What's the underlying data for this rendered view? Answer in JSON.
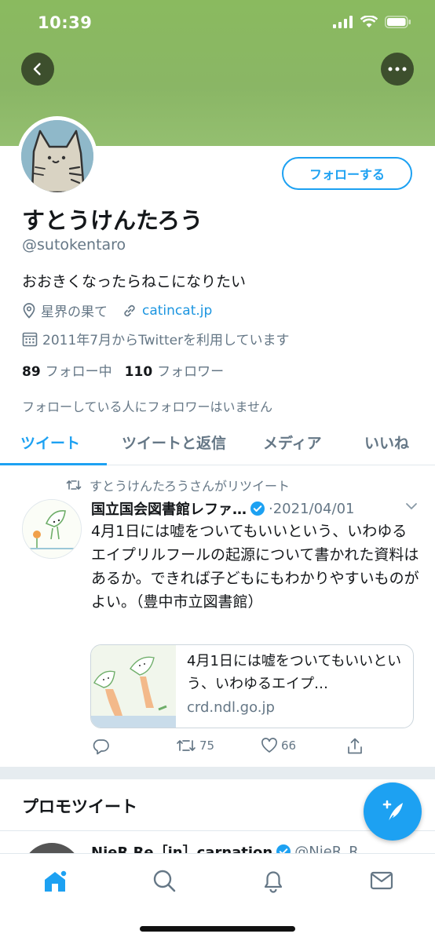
{
  "status_bar": {
    "time": "10:39"
  },
  "colors": {
    "accent": "#1da1f2",
    "banner": "#8ab665",
    "text_secondary": "#657786"
  },
  "header": {
    "back_icon": "chevron-left-icon",
    "more_icon": "more-horizontal-icon"
  },
  "profile": {
    "follow_label": "フォローする",
    "name": "すとうけんたろう",
    "handle": "@sutokentaro",
    "bio": "おおきくなったらねこになりたい",
    "location": "星界の果て",
    "website": "catincat.jp",
    "joined": "2011年7月からTwitterを利用しています",
    "following_count": "89",
    "following_label": "フォロー中",
    "followers_count": "110",
    "followers_label": "フォロワー",
    "no_mutual_followers": "フォローしている人にフォロワーはいません"
  },
  "tabs": [
    {
      "label": "ツイート",
      "active": true
    },
    {
      "label": "ツイートと返信",
      "active": false
    },
    {
      "label": "メディア",
      "active": false
    },
    {
      "label": "いいね",
      "active": false
    }
  ],
  "tweet": {
    "retweeted_by": "すとうけんたろうさんがリツイート",
    "author": "国立国会図書館レファ…",
    "verified": true,
    "date": "·2021/04/01",
    "text": "4月1日には嘘をついてもいいという、いわゆるエイプリルフールの起源について書かれた資料はあるか。できれば子どもにもわかりやすいものがよい。（豊中市立図書館）",
    "card": {
      "title": "4月1日には嘘をついてもいいという、いわゆるエイプ…",
      "domain": "crd.ndl.go.jp"
    },
    "actions": {
      "reply_count": "",
      "retweet_count": "75",
      "like_count": "66"
    }
  },
  "promoted": {
    "section_title": "プロモツイート",
    "author": "NieR Re［in］carnation",
    "handle": "@NieR_R"
  },
  "bottom_nav": [
    "home-icon",
    "search-icon",
    "bell-icon",
    "mail-icon"
  ]
}
